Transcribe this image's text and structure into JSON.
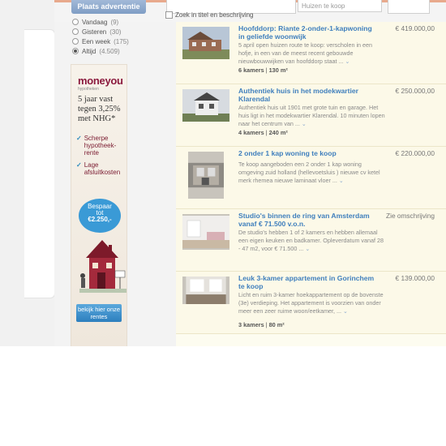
{
  "header": {
    "place_ad_label": "Plaats advertentie",
    "search_placeholder": "",
    "category_value": "Huizen te koop",
    "title_search_label": "Zoek in titel en beschrijving"
  },
  "date_filter": {
    "items": [
      {
        "label": "Vandaag",
        "count": "(9)",
        "checked": false
      },
      {
        "label": "Gisteren",
        "count": "(30)",
        "checked": false
      },
      {
        "label": "Een week",
        "count": "(175)",
        "checked": false
      },
      {
        "label": "Altijd",
        "count": "(4.509)",
        "checked": true
      }
    ]
  },
  "banner": {
    "brand": "moneyou",
    "brand_sub": "hypotheken",
    "headline": "5 jaar vast tegen 3,25% met NHG*",
    "bullets": [
      "Scherpe hypotheek-rente",
      "Lage afsluitkosten"
    ],
    "bubble_line1": "Bespaar",
    "bubble_line2": "tot",
    "bubble_amount": "€2.250,-",
    "cta": "bekijk hier onze rentes",
    "accent": "#8b1a3e",
    "blue": "#3a9ad6"
  },
  "listings": [
    {
      "title": "Hoofddorp: Riante 2-onder-1-kapwoning in geliefde woonwijk",
      "price": "€ 419.000,00",
      "description": "5 april open huizen route te koop: verscholen in een hofje, in een van de meest recent gebouwde nieuwbouwwijken van hoofddorp staat ...",
      "rooms": "6 kamers",
      "area": "130 m²"
    },
    {
      "title": "Authentiek huis in het modekwartier Klarendal",
      "price": "€ 250.000,00",
      "description": "Authentiek huis uit 1901 met grote tuin en garage. Het huis ligt in het modekwartier Klarendal. 10 minuten lopen naar het centrum van ...",
      "rooms": "4 kamers",
      "area": "240 m²"
    },
    {
      "title": "2 onder 1 kap woning te koop",
      "price": "€ 220.000,00",
      "description": "Te koop aangeboden een 2 onder 1 kap woning omgeving zuid holland (hellevoetsluis ) nieuwe cv ketel merk rhemea nieuwe laminaat vloer ...",
      "rooms": "",
      "area": ""
    },
    {
      "title": "Studio's binnen de ring van Amsterdam vanaf € 71.500 v.o.n.",
      "price": "Zie omschrijving",
      "description": "De studio's hebben 1 of 2 kamers en hebben allemaal een eigen keuken en badkamer. Opleverdatum vanaf 28 - 47 m2, voor € 71.500 ...",
      "rooms": "",
      "area": ""
    },
    {
      "title": "Leuk 3-kamer appartement in Gorinchem te koop",
      "price": "€ 139.000,00",
      "description": "Licht en ruim 3-kamer hoekappartement op de bovenste (3e) verdieping. Het appartement is voorzien van onder meer een zeer ruime woon/eetkamer, ...",
      "rooms": "3 kamers",
      "area": "80 m²"
    }
  ],
  "meta_separator": "|"
}
